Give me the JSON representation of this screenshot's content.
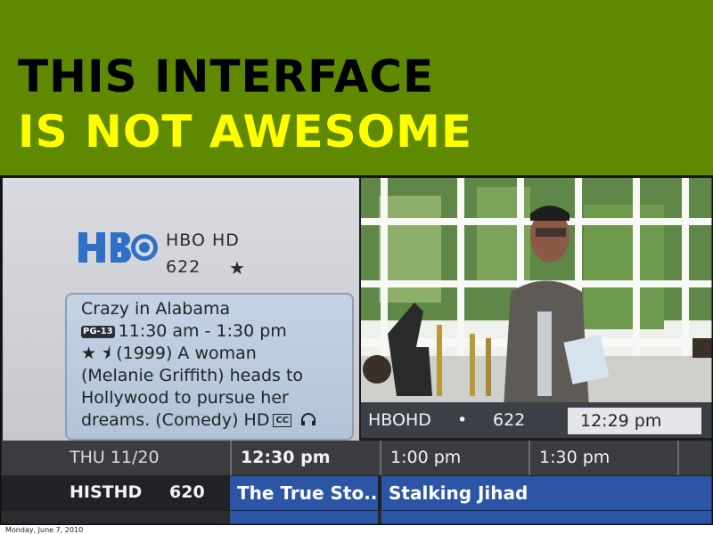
{
  "headline": {
    "line1": "THIS INTERFACE",
    "line2": "IS NOT AWESOME"
  },
  "guide": {
    "logo_text": "HBO",
    "channel_name": "HBO HD",
    "channel_number": "622",
    "favorite_icon": "star-icon",
    "info": {
      "title": "Crazy in Alabama",
      "rating": "PG-13",
      "time": "11:30 am - 1:30 pm",
      "stars": "★ ⯨",
      "desc_line1": "(1999) A woman",
      "desc_line2": "(Melanie Griffith) heads to",
      "desc_line3": "Hollywood to pursue her",
      "desc_line4": "dreams. (Comedy) HD",
      "cc": "CC",
      "audio_icon": "headphones-icon"
    },
    "status": {
      "channel": "HBOHD",
      "separator": "•",
      "number": "622",
      "time": "12:29 pm"
    },
    "grid": {
      "date": "THU 11/20",
      "times": [
        "12:30 pm",
        "1:00 pm",
        "1:30 pm"
      ],
      "rows": [
        {
          "channel": "HISTHD",
          "number": "620",
          "programs": [
            "The True Sto...",
            "Stalking Jihad"
          ]
        }
      ]
    }
  },
  "caption": "Monday, June 7, 2010",
  "colors": {
    "banner": "#5f8a00",
    "headline_line1": "#000000",
    "headline_line2": "#ffff00",
    "program_cell": "#2d55a6"
  }
}
